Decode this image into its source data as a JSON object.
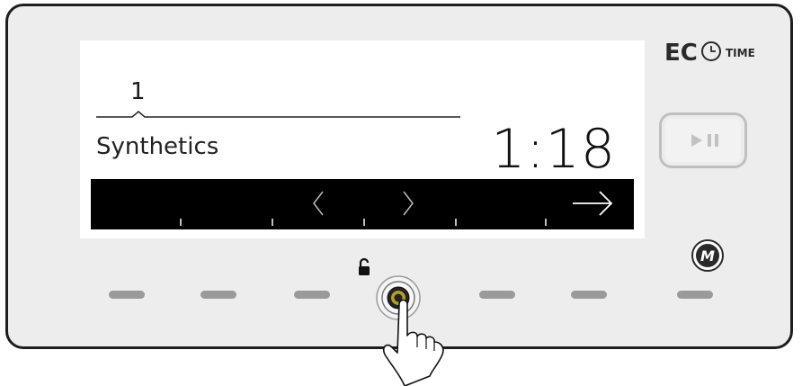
{
  "display": {
    "program_number": "1",
    "program_name": "Synthetics",
    "time_remaining": "1:18"
  },
  "nav_bar": {
    "left_arrow": "chevron-left-icon",
    "right_arrow": "chevron-right-icon",
    "next_arrow": "arrow-right-icon"
  },
  "branding": {
    "logo_text_main": "EC",
    "logo_text_time": "TIME"
  },
  "controls": {
    "play_pause_icon": "play-pause-icon",
    "m_label": "M",
    "lock_icon": "lock-icon",
    "touch_buttons_count": 7
  },
  "colors": {
    "panel_bg": "#ededed",
    "screen_bg": "#ffffff",
    "active_touch": "#b8a21a"
  }
}
